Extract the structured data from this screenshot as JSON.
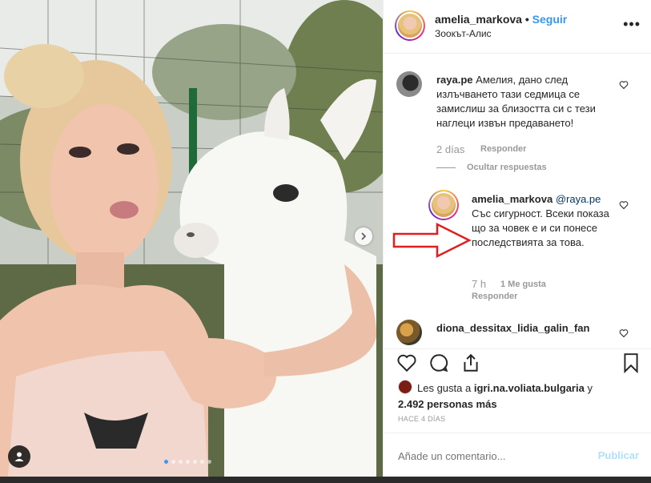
{
  "header": {
    "username": "amelia_markova",
    "separator": "•",
    "follow": "Seguir",
    "location": "Зоокът-Алис",
    "more": "•••"
  },
  "comments": [
    {
      "user": "raya.pe",
      "text": "Амелия, дано след излъчването тази седмица се замислиш за близостта си с тези наглеци извън предаването!",
      "time": "2 días",
      "reply": "Responder",
      "hide_replies": "Ocultar respuestas"
    },
    {
      "user": "amelia_markova",
      "mention": "@raya.pe",
      "text": "Със сигурност. Всеки показа що за човек е и си понесе последствията за това.",
      "time": "7 h",
      "likes": "1 Me gusta",
      "reply": "Responder"
    },
    {
      "user": "diona_dessitax_lidia_galin_fan"
    }
  ],
  "likes": {
    "prefix": "Les gusta a",
    "user": "igri.na.voliata.bulgaria",
    "and": "y",
    "count": "2.492 personas más"
  },
  "timestamp": "HACE 4 DÍAS",
  "add_comment": {
    "placeholder": "Añade un comentario...",
    "publish": "Publicar"
  },
  "colors": {
    "link": "#3897f0",
    "arrow": "#e02020",
    "muted": "#999999"
  },
  "carousel": {
    "slides": 7,
    "active_index": 0
  }
}
